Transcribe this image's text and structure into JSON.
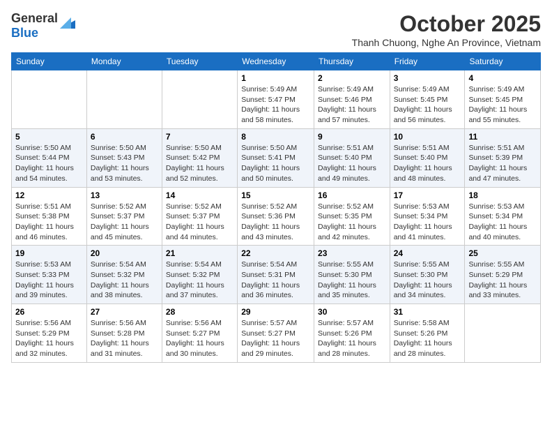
{
  "logo": {
    "text_general": "General",
    "text_blue": "Blue",
    "arrow_color": "#1a6ec2"
  },
  "title": {
    "month_year": "October 2025",
    "location": "Thanh Chuong, Nghe An Province, Vietnam"
  },
  "weekdays": [
    "Sunday",
    "Monday",
    "Tuesday",
    "Wednesday",
    "Thursday",
    "Friday",
    "Saturday"
  ],
  "weeks": [
    [
      {
        "day": "",
        "info": ""
      },
      {
        "day": "",
        "info": ""
      },
      {
        "day": "",
        "info": ""
      },
      {
        "day": "1",
        "info": "Sunrise: 5:49 AM\nSunset: 5:47 PM\nDaylight: 11 hours and 58 minutes."
      },
      {
        "day": "2",
        "info": "Sunrise: 5:49 AM\nSunset: 5:46 PM\nDaylight: 11 hours and 57 minutes."
      },
      {
        "day": "3",
        "info": "Sunrise: 5:49 AM\nSunset: 5:45 PM\nDaylight: 11 hours and 56 minutes."
      },
      {
        "day": "4",
        "info": "Sunrise: 5:49 AM\nSunset: 5:45 PM\nDaylight: 11 hours and 55 minutes."
      }
    ],
    [
      {
        "day": "5",
        "info": "Sunrise: 5:50 AM\nSunset: 5:44 PM\nDaylight: 11 hours and 54 minutes."
      },
      {
        "day": "6",
        "info": "Sunrise: 5:50 AM\nSunset: 5:43 PM\nDaylight: 11 hours and 53 minutes."
      },
      {
        "day": "7",
        "info": "Sunrise: 5:50 AM\nSunset: 5:42 PM\nDaylight: 11 hours and 52 minutes."
      },
      {
        "day": "8",
        "info": "Sunrise: 5:50 AM\nSunset: 5:41 PM\nDaylight: 11 hours and 50 minutes."
      },
      {
        "day": "9",
        "info": "Sunrise: 5:51 AM\nSunset: 5:40 PM\nDaylight: 11 hours and 49 minutes."
      },
      {
        "day": "10",
        "info": "Sunrise: 5:51 AM\nSunset: 5:40 PM\nDaylight: 11 hours and 48 minutes."
      },
      {
        "day": "11",
        "info": "Sunrise: 5:51 AM\nSunset: 5:39 PM\nDaylight: 11 hours and 47 minutes."
      }
    ],
    [
      {
        "day": "12",
        "info": "Sunrise: 5:51 AM\nSunset: 5:38 PM\nDaylight: 11 hours and 46 minutes."
      },
      {
        "day": "13",
        "info": "Sunrise: 5:52 AM\nSunset: 5:37 PM\nDaylight: 11 hours and 45 minutes."
      },
      {
        "day": "14",
        "info": "Sunrise: 5:52 AM\nSunset: 5:37 PM\nDaylight: 11 hours and 44 minutes."
      },
      {
        "day": "15",
        "info": "Sunrise: 5:52 AM\nSunset: 5:36 PM\nDaylight: 11 hours and 43 minutes."
      },
      {
        "day": "16",
        "info": "Sunrise: 5:52 AM\nSunset: 5:35 PM\nDaylight: 11 hours and 42 minutes."
      },
      {
        "day": "17",
        "info": "Sunrise: 5:53 AM\nSunset: 5:34 PM\nDaylight: 11 hours and 41 minutes."
      },
      {
        "day": "18",
        "info": "Sunrise: 5:53 AM\nSunset: 5:34 PM\nDaylight: 11 hours and 40 minutes."
      }
    ],
    [
      {
        "day": "19",
        "info": "Sunrise: 5:53 AM\nSunset: 5:33 PM\nDaylight: 11 hours and 39 minutes."
      },
      {
        "day": "20",
        "info": "Sunrise: 5:54 AM\nSunset: 5:32 PM\nDaylight: 11 hours and 38 minutes."
      },
      {
        "day": "21",
        "info": "Sunrise: 5:54 AM\nSunset: 5:32 PM\nDaylight: 11 hours and 37 minutes."
      },
      {
        "day": "22",
        "info": "Sunrise: 5:54 AM\nSunset: 5:31 PM\nDaylight: 11 hours and 36 minutes."
      },
      {
        "day": "23",
        "info": "Sunrise: 5:55 AM\nSunset: 5:30 PM\nDaylight: 11 hours and 35 minutes."
      },
      {
        "day": "24",
        "info": "Sunrise: 5:55 AM\nSunset: 5:30 PM\nDaylight: 11 hours and 34 minutes."
      },
      {
        "day": "25",
        "info": "Sunrise: 5:55 AM\nSunset: 5:29 PM\nDaylight: 11 hours and 33 minutes."
      }
    ],
    [
      {
        "day": "26",
        "info": "Sunrise: 5:56 AM\nSunset: 5:29 PM\nDaylight: 11 hours and 32 minutes."
      },
      {
        "day": "27",
        "info": "Sunrise: 5:56 AM\nSunset: 5:28 PM\nDaylight: 11 hours and 31 minutes."
      },
      {
        "day": "28",
        "info": "Sunrise: 5:56 AM\nSunset: 5:27 PM\nDaylight: 11 hours and 30 minutes."
      },
      {
        "day": "29",
        "info": "Sunrise: 5:57 AM\nSunset: 5:27 PM\nDaylight: 11 hours and 29 minutes."
      },
      {
        "day": "30",
        "info": "Sunrise: 5:57 AM\nSunset: 5:26 PM\nDaylight: 11 hours and 28 minutes."
      },
      {
        "day": "31",
        "info": "Sunrise: 5:58 AM\nSunset: 5:26 PM\nDaylight: 11 hours and 28 minutes."
      },
      {
        "day": "",
        "info": ""
      }
    ]
  ]
}
